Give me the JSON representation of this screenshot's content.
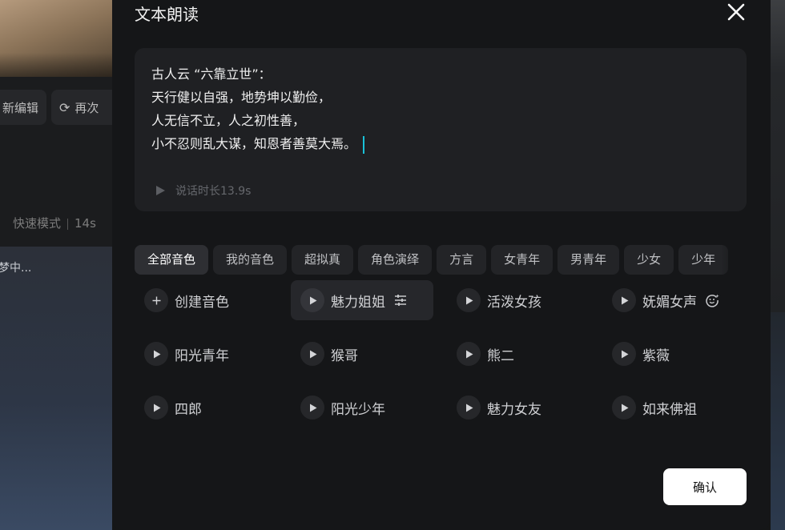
{
  "background": {
    "edit_label": "新编辑",
    "regenerate_label": "再次",
    "mode_label": "快速模式",
    "mode_extra": "14s",
    "panel_text": "梦中..."
  },
  "dialog": {
    "title": "文本朗读",
    "text_lines": [
      "古人云 “六靠立世”：",
      "天行健以自强，地势坤以勤俭，",
      "人无信不立，人之初性善，",
      "小不忍则乱大谋，知恩者善莫大焉。"
    ],
    "duration_label": "说话时长13.9s",
    "tabs": [
      {
        "label": "全部音色",
        "active": true
      },
      {
        "label": "我的音色"
      },
      {
        "label": "超拟真"
      },
      {
        "label": "角色演绎"
      },
      {
        "label": "方言"
      },
      {
        "label": "女青年"
      },
      {
        "label": "男青年"
      },
      {
        "label": "少女"
      },
      {
        "label": "少年"
      }
    ],
    "voices": [
      {
        "label": "创建音色",
        "icon": "plus-icon"
      },
      {
        "label": "魅力姐姐",
        "icon": "play-icon",
        "selected": true,
        "extra_icon": "settings-sliders-icon"
      },
      {
        "label": "活泼女孩",
        "icon": "play-icon"
      },
      {
        "label": "妩媚女声",
        "icon": "play-icon",
        "extra_icon": "emotion-face-icon"
      },
      {
        "label": "阳光青年",
        "icon": "play-icon"
      },
      {
        "label": "猴哥",
        "icon": "play-icon"
      },
      {
        "label": "熊二",
        "icon": "play-icon"
      },
      {
        "label": "紫薇",
        "icon": "play-icon"
      },
      {
        "label": "四郎",
        "icon": "play-icon"
      },
      {
        "label": "阳光少年",
        "icon": "play-icon"
      },
      {
        "label": "魅力女友",
        "icon": "play-icon"
      },
      {
        "label": "如来佛祖",
        "icon": "play-icon"
      }
    ],
    "confirm_label": "确认"
  },
  "colors": {
    "dialog_bg": "#151618",
    "textbox_bg": "#1f2023",
    "caret": "#19c1d8",
    "confirm_bg": "#ffffff"
  }
}
